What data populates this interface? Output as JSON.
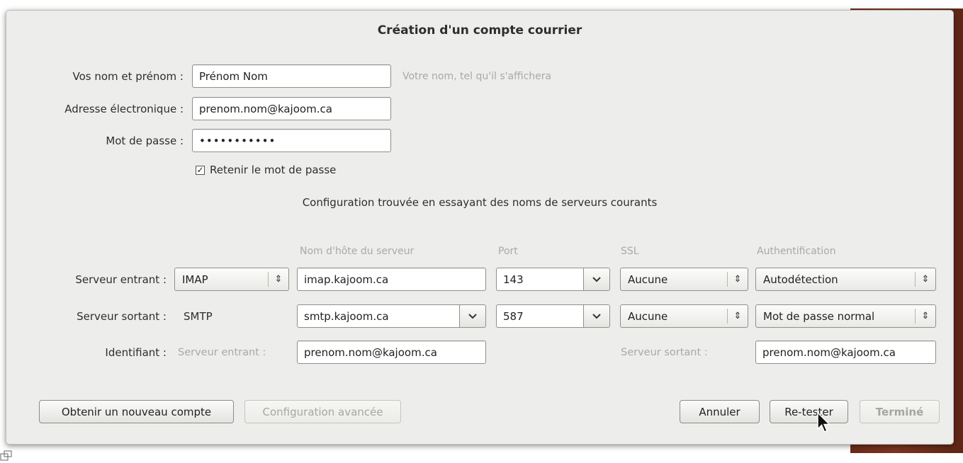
{
  "dialog": {
    "title": "Création d'un compte courrier",
    "name_label": "Vos nom et prénom :",
    "name_value": "Prénom Nom",
    "name_hint": "Votre nom, tel qu'il s'affichera",
    "email_label": "Adresse électronique :",
    "email_value": "prenom.nom@kajoom.ca",
    "password_label": "Mot de passe :",
    "password_value": "•••••••••••",
    "remember_label": "Retenir le mot de passe",
    "remember_checked": true,
    "status_text": "Configuration trouvée en essayant des noms de serveurs courants"
  },
  "servers": {
    "headers": {
      "hostname": "Nom d'hôte du serveur",
      "port": "Port",
      "ssl": "SSL",
      "auth": "Authentification"
    },
    "incoming": {
      "label": "Serveur entrant :",
      "protocol": "IMAP",
      "hostname": "imap.kajoom.ca",
      "port": "143",
      "ssl": "Aucune",
      "auth": "Autodétection"
    },
    "outgoing": {
      "label": "Serveur sortant :",
      "protocol": "SMTP",
      "hostname": "smtp.kajoom.ca",
      "port": "587",
      "ssl": "Aucune",
      "auth": "Mot de passe normal"
    },
    "identifier": {
      "label": "Identifiant :",
      "incoming_label": "Serveur entrant :",
      "incoming_value": "prenom.nom@kajoom.ca",
      "outgoing_label": "Serveur sortant :",
      "outgoing_value": "prenom.nom@kajoom.ca"
    }
  },
  "buttons": {
    "new_account": "Obtenir un nouveau compte",
    "advanced": "Configuration avancée",
    "cancel": "Annuler",
    "retest": "Re-tester",
    "done": "Terminé"
  },
  "icons": {
    "combo_arrows": "⇕",
    "dropdown": "chevron-down",
    "cursor": "mouse-pointer"
  }
}
